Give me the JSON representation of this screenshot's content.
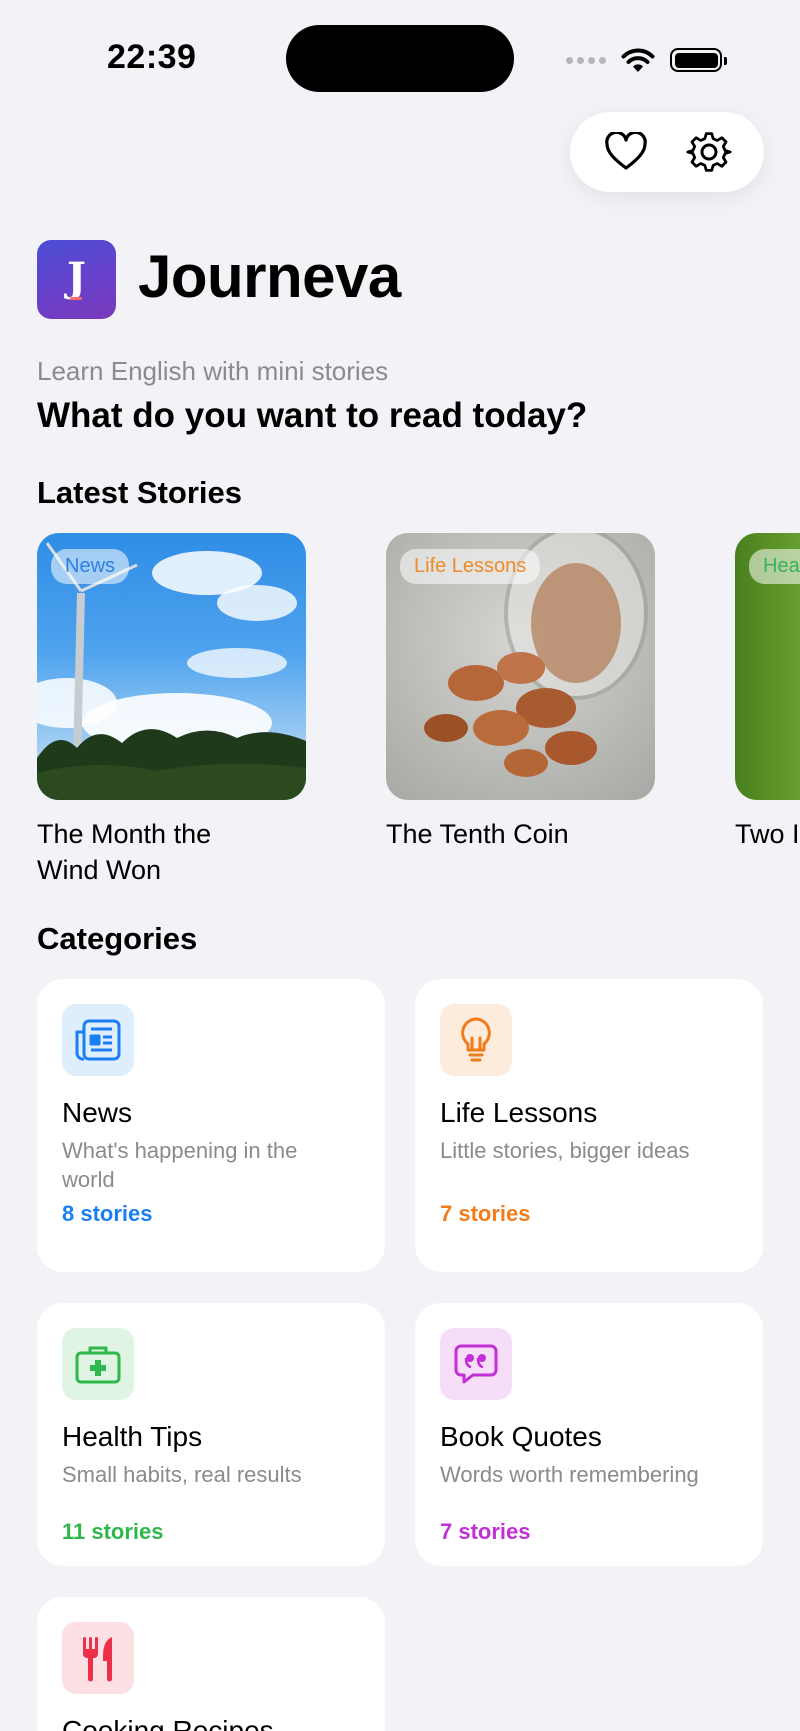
{
  "status_bar": {
    "time": "22:39"
  },
  "app": {
    "name": "Journeva",
    "logo_letter": "J",
    "tagline": "Learn English with mini stories",
    "headline": "What do you want to read today?"
  },
  "sections": {
    "latest": "Latest Stories",
    "categories": "Categories"
  },
  "stories": [
    {
      "tag": "News",
      "tag_color": "#2f7fe0",
      "title": "The Month the Wind Won"
    },
    {
      "tag": "Life Lessons",
      "tag_color": "#f08a2a",
      "title": "The Tenth Coin"
    },
    {
      "tag": "Hea",
      "tag_color": "#34b35a",
      "title": "Two I"
    }
  ],
  "categories": [
    {
      "name": "News",
      "desc": "What's happening in the world",
      "count": "8 stories",
      "color": "#1a7ff0",
      "icon": "newspaper-icon"
    },
    {
      "name": "Life Lessons",
      "desc": "Little stories, bigger ideas",
      "count": "7 stories",
      "color": "#f07d1a",
      "icon": "lightbulb-icon"
    },
    {
      "name": "Health Tips",
      "desc": "Small habits, real results",
      "count": "11 stories",
      "color": "#2eb84a",
      "icon": "medical-kit-icon"
    },
    {
      "name": "Book Quotes",
      "desc": "Words worth remembering",
      "count": "7 stories",
      "color": "#c22fd6",
      "icon": "quote-bubble-icon"
    },
    {
      "name": "Cooking Recipes",
      "desc": "",
      "count": "",
      "color": "#ee2f4a",
      "icon": "fork-knife-icon"
    }
  ]
}
